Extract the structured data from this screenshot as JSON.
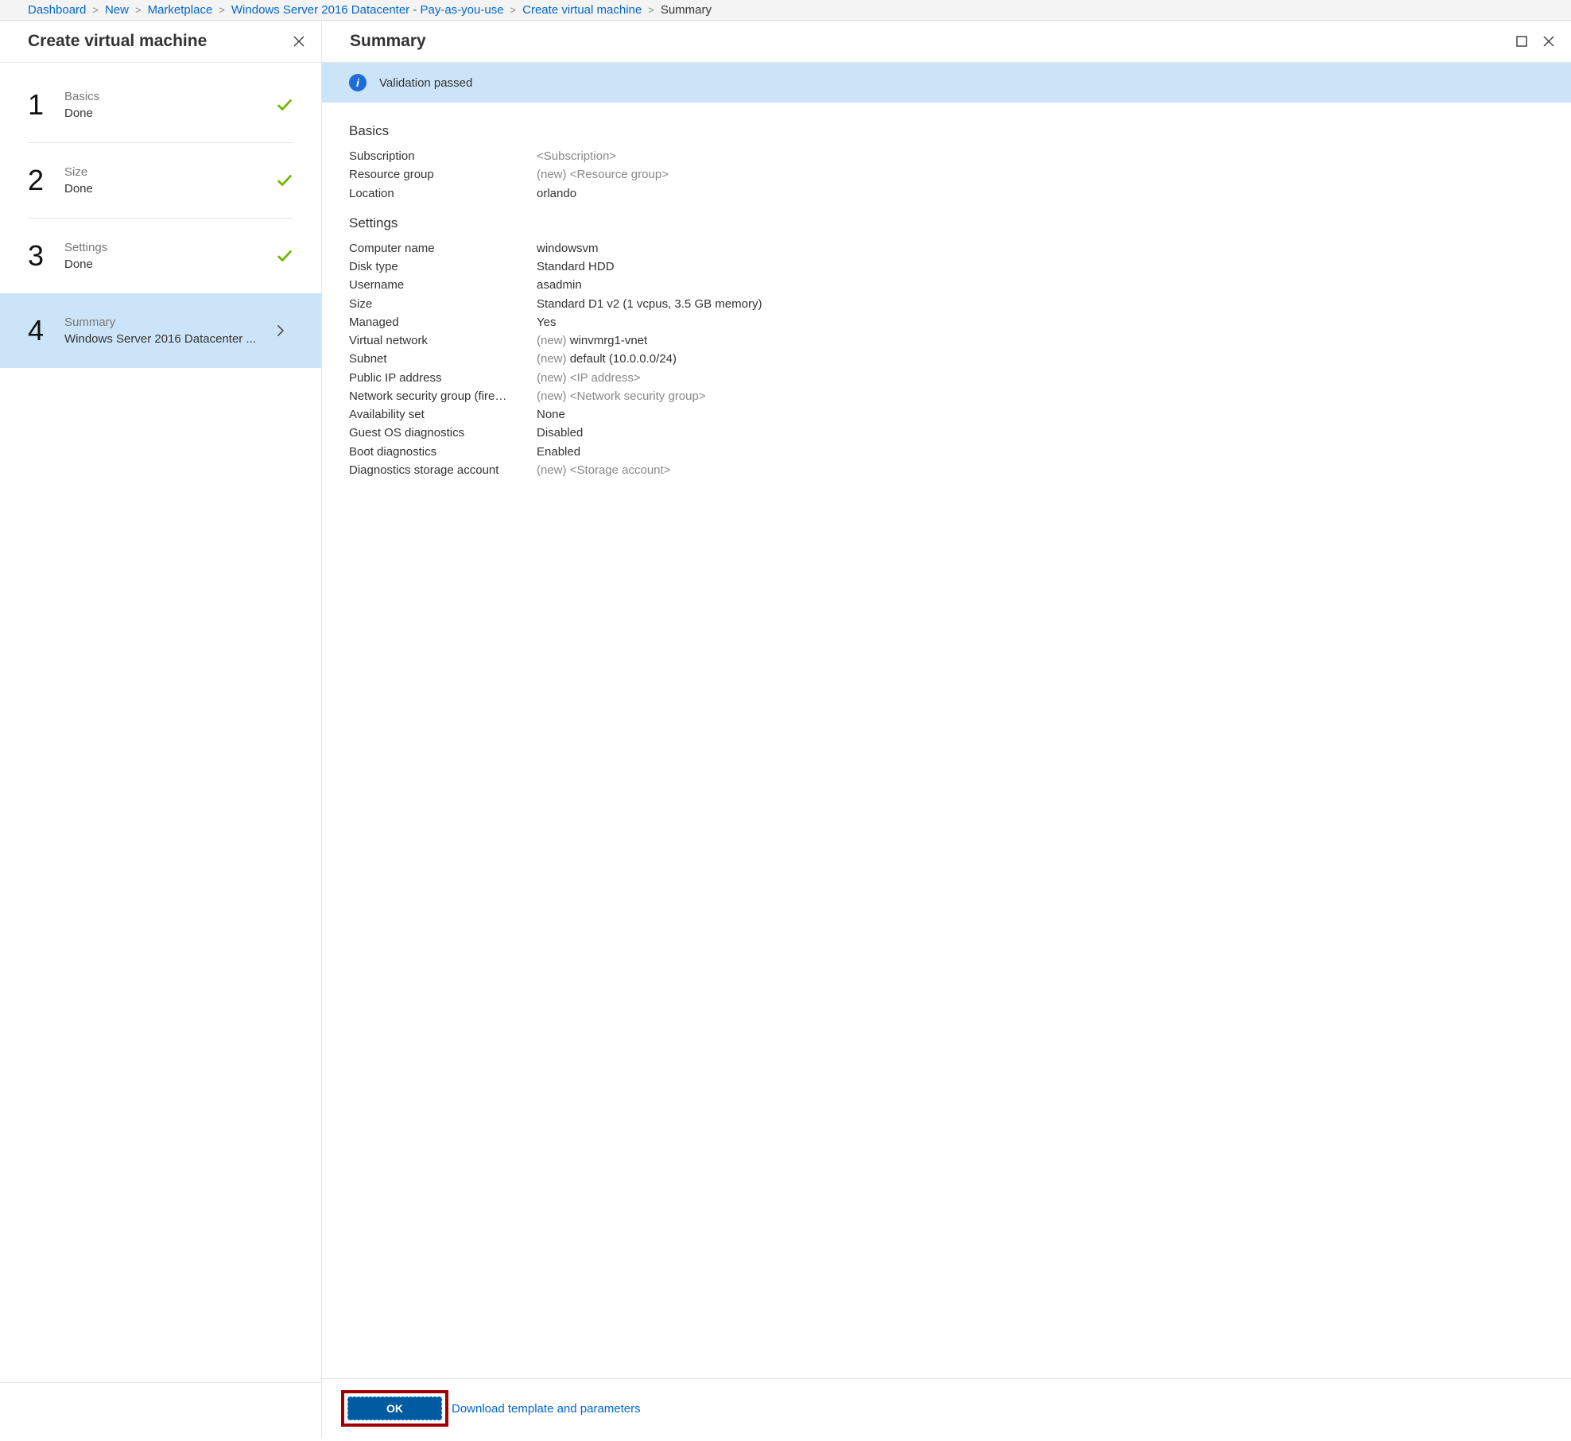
{
  "breadcrumb": [
    {
      "label": "Dashboard",
      "current": false
    },
    {
      "label": "New",
      "current": false
    },
    {
      "label": "Marketplace",
      "current": false
    },
    {
      "label": "Windows Server 2016 Datacenter - Pay-as-you-use",
      "current": false
    },
    {
      "label": "Create virtual machine",
      "current": false
    },
    {
      "label": "Summary",
      "current": true
    }
  ],
  "leftPane": {
    "title": "Create virtual machine",
    "steps": [
      {
        "num": "1",
        "label": "Basics",
        "status": "Done",
        "state": "done"
      },
      {
        "num": "2",
        "label": "Size",
        "status": "Done",
        "state": "done"
      },
      {
        "num": "3",
        "label": "Settings",
        "status": "Done",
        "state": "done"
      },
      {
        "num": "4",
        "label": "Summary",
        "status": "Windows Server 2016 Datacenter ...",
        "state": "selected"
      }
    ]
  },
  "rightPane": {
    "title": "Summary",
    "validation": "Validation passed",
    "sections": [
      {
        "heading": "Basics",
        "rows": [
          {
            "key": "Subscription",
            "new": false,
            "val": "<Subscription>",
            "placeholder": true
          },
          {
            "key": "Resource group",
            "new": true,
            "val": "<Resource group>",
            "placeholder": true
          },
          {
            "key": "Location",
            "new": false,
            "val": "orlando",
            "placeholder": false
          }
        ]
      },
      {
        "heading": "Settings",
        "rows": [
          {
            "key": "Computer name",
            "new": false,
            "val": "windowsvm",
            "placeholder": false
          },
          {
            "key": "Disk type",
            "new": false,
            "val": "Standard HDD",
            "placeholder": false
          },
          {
            "key": "Username",
            "new": false,
            "val": "asadmin",
            "placeholder": false
          },
          {
            "key": "Size",
            "new": false,
            "val": "Standard D1 v2 (1 vcpus, 3.5 GB memory)",
            "placeholder": false
          },
          {
            "key": "Managed",
            "new": false,
            "val": "Yes",
            "placeholder": false
          },
          {
            "key": "Virtual network",
            "new": true,
            "val": "winvmrg1-vnet",
            "placeholder": false
          },
          {
            "key": "Subnet",
            "new": true,
            "val": "default (10.0.0.0/24)",
            "placeholder": false
          },
          {
            "key": "Public IP address",
            "new": true,
            "val": "<IP address>",
            "placeholder": true
          },
          {
            "key": "Network security group (fire…",
            "new": true,
            "val": "<Network security group>",
            "placeholder": true
          },
          {
            "key": "Availability set",
            "new": false,
            "val": "None",
            "placeholder": false
          },
          {
            "key": "Guest OS diagnostics",
            "new": false,
            "val": "Disabled",
            "placeholder": false
          },
          {
            "key": "Boot diagnostics",
            "new": false,
            "val": "Enabled",
            "placeholder": false
          },
          {
            "key": "Diagnostics storage account",
            "new": true,
            "val": "<Storage account>",
            "placeholder": true
          }
        ]
      }
    ],
    "newPrefix": "(new) ",
    "okLabel": "OK",
    "downloadLabel": "Download template and parameters"
  }
}
